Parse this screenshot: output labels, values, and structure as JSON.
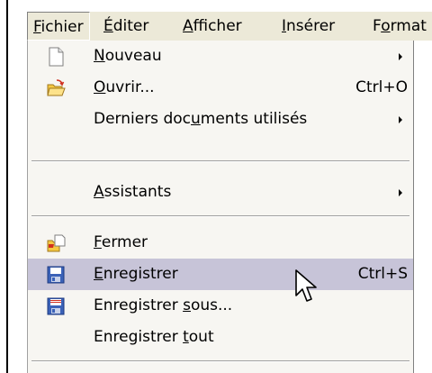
{
  "menubar": {
    "items": [
      {
        "pre": "",
        "mn": "F",
        "post": "ichier"
      },
      {
        "pre": "",
        "mn": "É",
        "post": "diter"
      },
      {
        "pre": "",
        "mn": "A",
        "post": "fficher"
      },
      {
        "pre": "",
        "mn": "I",
        "post": "nsérer"
      },
      {
        "pre": "F",
        "mn": "o",
        "post": "rmat"
      }
    ]
  },
  "menu": {
    "nouveau": {
      "pre": "",
      "mn": "N",
      "post": "ouveau"
    },
    "ouvrir": {
      "pre": "",
      "mn": "O",
      "post": "uvrir...",
      "shortcut": "Ctrl+O"
    },
    "derniers": {
      "pre": "Derniers doc",
      "mn": "u",
      "post": "ments utilisés"
    },
    "assistants": {
      "pre": "",
      "mn": "A",
      "post": "ssistants"
    },
    "fermer": {
      "pre": "",
      "mn": "F",
      "post": "ermer"
    },
    "enregistrer": {
      "pre": "",
      "mn": "E",
      "post": "nregistrer",
      "shortcut": "Ctrl+S"
    },
    "enregistrer_sous": {
      "pre": "Enregistrer ",
      "mn": "s",
      "post": "ous..."
    },
    "enregistrer_tout": {
      "pre": "Enregistrer ",
      "mn": "t",
      "post": "out"
    }
  },
  "icons": {
    "nouveau": "new-document-icon",
    "ouvrir": "open-folder-icon",
    "fermer": "close-document-icon",
    "enregistrer": "save-icon",
    "enregistrer_sous": "save-as-icon",
    "cursor": "mouse-pointer-icon"
  },
  "colors": {
    "menubar_bg": "#ece9d8",
    "menu_bg": "#f7f6f2",
    "hover_bg": "#c7c4d8"
  }
}
